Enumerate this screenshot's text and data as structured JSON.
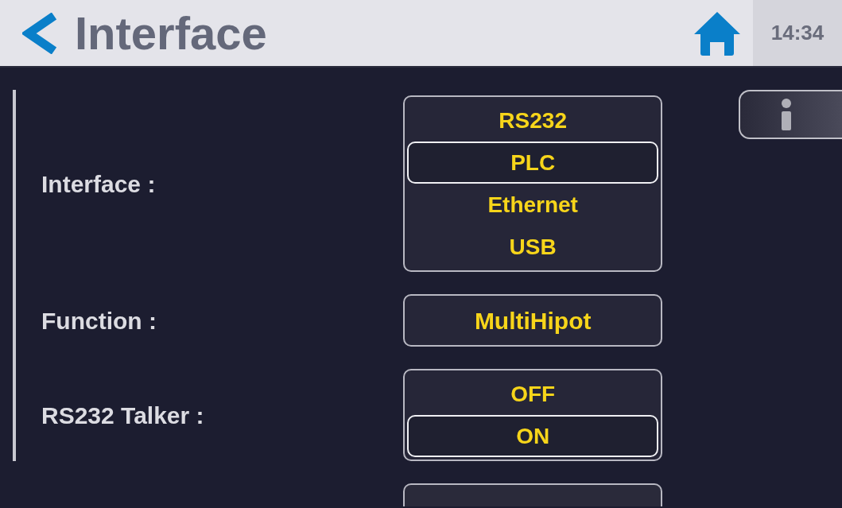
{
  "header": {
    "title": "Interface",
    "time": "14:34"
  },
  "rows": [
    {
      "label": "Interface :",
      "kind": "list",
      "options": [
        {
          "label": "RS232",
          "selected": false
        },
        {
          "label": "PLC",
          "selected": true
        },
        {
          "label": "Ethernet",
          "selected": false
        },
        {
          "label": "USB",
          "selected": false
        }
      ]
    },
    {
      "label": "Function :",
      "kind": "value",
      "value": "MultiHipot"
    },
    {
      "label": "RS232 Talker :",
      "kind": "list",
      "options": [
        {
          "label": "OFF",
          "selected": false
        },
        {
          "label": "ON",
          "selected": true
        }
      ]
    }
  ]
}
